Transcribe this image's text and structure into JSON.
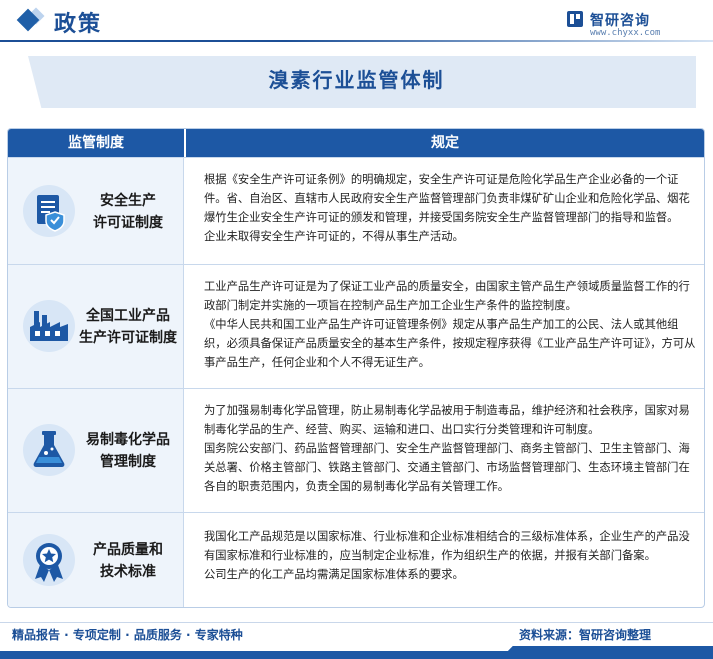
{
  "header": {
    "section_title": "政策",
    "logo_name": "智研咨询",
    "logo_url": "www.chyxx.com"
  },
  "banner": {
    "title": "溴素行业监管体制"
  },
  "table": {
    "col_system": "监管制度",
    "col_rules": "规定",
    "rows": [
      {
        "name_line1": "安全生产",
        "name_line2": "许可证制度",
        "icon": "shield-document-icon",
        "text": [
          "根据《安全生产许可证条例》的明确规定，安全生产许可证是危险化学品生产企业必备的一个证件。省、自治区、直辖市人民政府安全生产监督管理部门负责非煤矿矿山企业和危险化学品、烟花爆竹生企业安全生产许可证的颁发和管理，并接受国务院安全生产监督管理部门的指导和监督。",
          "企业未取得安全生产许可证的，不得从事生产活动。"
        ]
      },
      {
        "name_line1": "全国工业产品",
        "name_line2": "生产许可证制度",
        "icon": "factory-icon",
        "text": [
          "工业产品生产许可证是为了保证工业产品的质量安全，由国家主管产品生产领域质量监督工作的行政部门制定并实施的一项旨在控制产品生产加工企业生产条件的监控制度。",
          "《中华人民共和国工业产品生产许可证管理条例》规定从事产品生产加工的公民、法人或其他组织，必须具备保证产品质量安全的基本生产条件，按规定程序获得《工业产品生产许可证》，方可从事产品生产，任何企业和个人不得无证生产。"
        ]
      },
      {
        "name_line1": "易制毒化学品",
        "name_line2": "管理制度",
        "icon": "flask-icon",
        "text": [
          "为了加强易制毒化学品管理，防止易制毒化学品被用于制造毒品，维护经济和社会秩序，国家对易制毒化学品的生产、经营、购买、运输和进口、出口实行分类管理和许可制度。",
          "国务院公安部门、药品监督管理部门、安全生产监督管理部门、商务主管部门、卫生主管部门、海关总署、价格主管部门、铁路主管部门、交通主管部门、市场监督管理部门、生态环境主管部门在各自的职责范围内，负责全国的易制毒化学品有关管理工作。"
        ]
      },
      {
        "name_line1": "产品质量和",
        "name_line2": "技术标准",
        "icon": "award-medal-icon",
        "text": [
          "我国化工产品规范是以国家标准、行业标准和企业标准相结合的三级标准体系，企业生产的产品没有国家标准和行业标准的，应当制定企业标准，作为组织生产的依据，并报有关部门备案。",
          "公司生产的化工产品均需满足国家标准体系的要求。"
        ]
      }
    ]
  },
  "footer": {
    "tagline": "精品报告 · 专项定制 · 品质服务 · 专家特种",
    "source": "资料来源：智研咨询整理"
  },
  "colors": {
    "primary": "#1d58a5",
    "title_blue": "#1c4f96",
    "light_bg": "#eef4fb"
  }
}
